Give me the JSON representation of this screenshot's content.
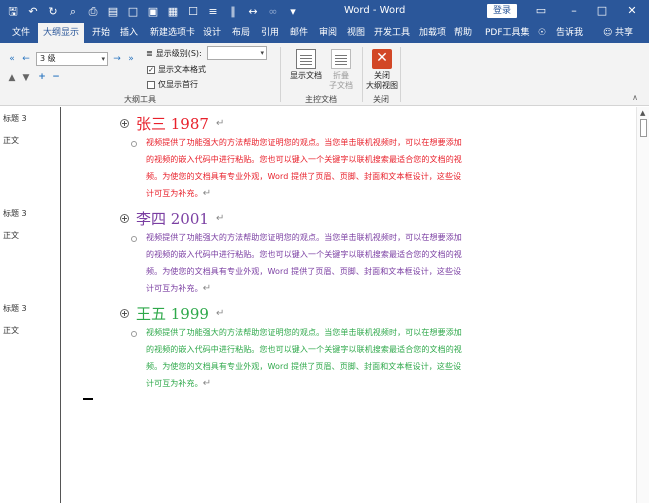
{
  "titlebar": {
    "title": "Word  -  Word",
    "login": "登录",
    "qat_icons": [
      "save-icon",
      "undo-icon",
      "redo-icon",
      "print-preview-icon",
      "print-icon",
      "open-icon",
      "new-doc-icon",
      "paste-icon",
      "table-icon",
      "clipboard-icon",
      "paragraph-icon",
      "columns-icon",
      "resize-icon",
      "link-icon",
      "dropdown-icon"
    ]
  },
  "tabs": [
    "文件",
    "大纲显示",
    "开始",
    "插入",
    "新建选项卡",
    "设计",
    "布局",
    "引用",
    "邮件",
    "审阅",
    "视图",
    "开发工具",
    "加载项",
    "帮助",
    "PDF工具集"
  ],
  "tell_me": "告诉我",
  "share": "共享",
  "ribbon": {
    "level_value": "3 级",
    "show_level_label": "显示级别(S):",
    "show_text_format": "显示文本格式",
    "show_first_line": "仅显示首行",
    "show_text_format_checked": true,
    "show_first_line_checked": false,
    "outline_tools_label": "大纲工具",
    "show_document": "显示文档",
    "collapse_subdoc_line1": "折叠",
    "collapse_subdoc_line2": "子文档",
    "master_doc_label": "主控文档",
    "close_view_line1": "关闭",
    "close_view_line2": "大纲视图",
    "close_label": "关闭"
  },
  "document": {
    "entries": [
      {
        "heading_style": "标题 3",
        "body_style": "正文",
        "heading": "张三 1987",
        "color": "#e8202b",
        "body": "视频提供了功能强大的方法帮助您证明您的观点。当您单击联机视频时，可以在想要添加的视频的嵌入代码中进行粘贴。您也可以键入一个关键字以联机搜索最适合您的文档的视频。为使您的文档具有专业外观，Word 提供了页眉、页脚、封面和文本框设计，这些设计可互为补充。"
      },
      {
        "heading_style": "标题 3",
        "body_style": "正文",
        "heading": "李四 2001",
        "color": "#7a3ea2",
        "body": "视频提供了功能强大的方法帮助您证明您的观点。当您单击联机视频时，可以在想要添加的视频的嵌入代码中进行粘贴。您也可以键入一个关键字以联机搜索最适合您的文档的视频。为使您的文档具有专业外观，Word 提供了页眉、页脚、封面和文本框设计，这些设计可互为补充。"
      },
      {
        "heading_style": "标题 3",
        "body_style": "正文",
        "heading": "王五 1999",
        "color": "#2ea84a",
        "body": "视频提供了功能强大的方法帮助您证明您的观点。当您单击联机视频时，可以在想要添加的视频的嵌入代码中进行粘贴。您也可以键入一个关键字以联机搜索最适合您的文档的视频。为使您的文档具有专业外观，Word 提供了页眉、页脚、封面和文本框设计，这些设计可互为补充。"
      }
    ]
  }
}
